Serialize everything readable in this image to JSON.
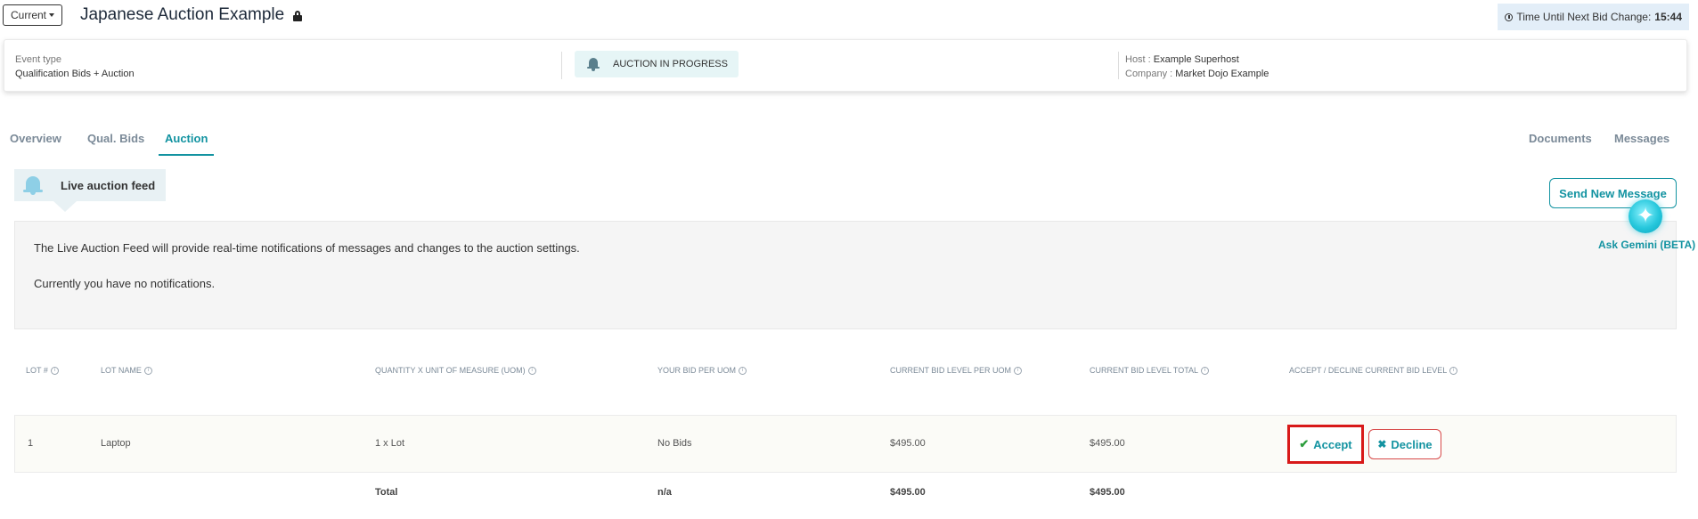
{
  "header": {
    "current_label": "Current",
    "title": "Japanese Auction Example",
    "timer_label": "Time Until Next Bid Change:",
    "timer_value": "15:44"
  },
  "event_info": {
    "event_type_label": "Event type",
    "event_type_value": "Qualification Bids + Auction",
    "status": "AUCTION IN PROGRESS",
    "host_label": "Host :",
    "host_value": "Example Superhost",
    "company_label": "Company :",
    "company_value": "Market Dojo Example"
  },
  "tabs": {
    "overview": "Overview",
    "qual_bids": "Qual. Bids",
    "auction": "Auction",
    "documents": "Documents",
    "messages": "Messages"
  },
  "feed": {
    "title": "Live auction feed",
    "line1": "The Live Auction Feed will provide real-time notifications of messages and changes to the auction settings.",
    "line2": "Currently you have no notifications."
  },
  "send_message_label": "Send New Message",
  "gemini_label": "Ask Gemini (BETA)",
  "table": {
    "headers": {
      "lot_no": "LOT #",
      "lot_name": "LOT NAME",
      "quantity": "QUANTITY X UNIT OF MEASURE (UOM)",
      "your_bid": "YOUR BID PER UOM",
      "current_per_uom": "CURRENT BID LEVEL PER UOM",
      "current_total": "CURRENT BID LEVEL TOTAL",
      "accept_decline": "ACCEPT / DECLINE CURRENT BID LEVEL"
    },
    "rows": [
      {
        "lot_no": "1",
        "lot_name": "Laptop",
        "quantity": "1 x Lot",
        "your_bid": "No Bids",
        "current_per_uom": "$495.00",
        "current_total": "$495.00"
      }
    ],
    "total": {
      "label": "Total",
      "your_bid": "n/a",
      "current_per_uom": "$495.00",
      "current_total": "$495.00"
    },
    "accept_label": "Accept",
    "decline_label": "Decline"
  },
  "icons": {
    "accent_color": "#1393a1",
    "accept_icon": "check-icon",
    "decline_icon": "x-icon"
  }
}
